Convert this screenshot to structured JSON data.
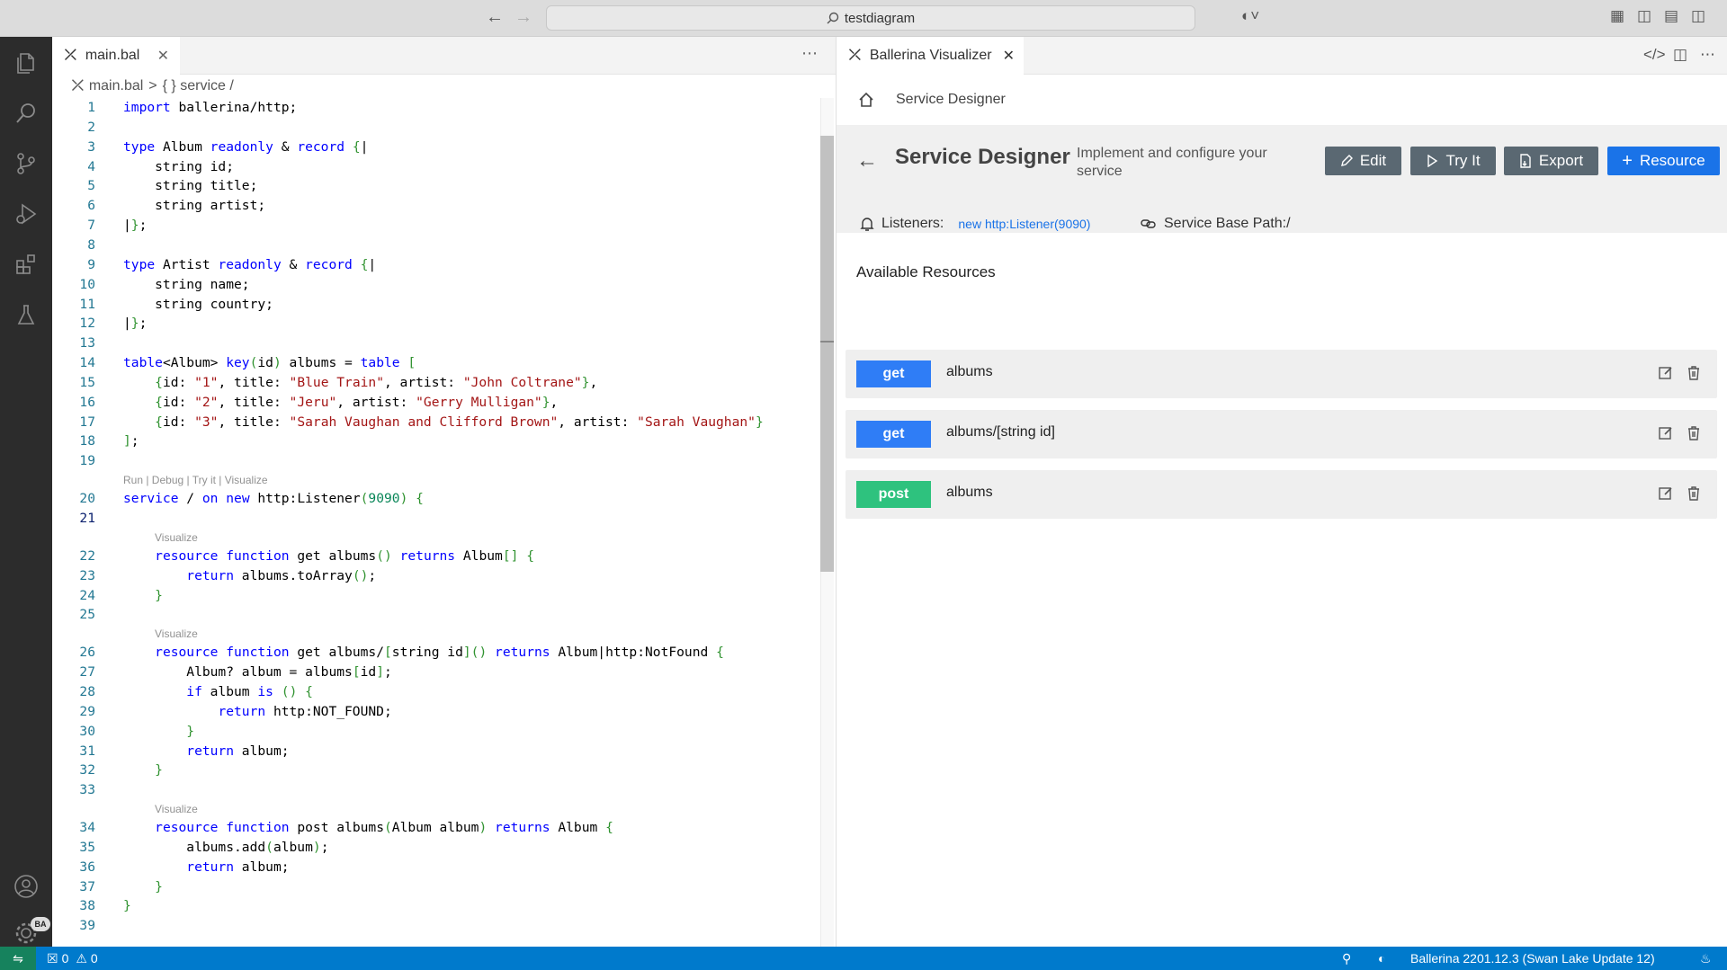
{
  "window": {
    "search_text": "testdiagram"
  },
  "activity_bar": {
    "account_badge": "BA"
  },
  "editor": {
    "tab_label": "main.bal",
    "breadcrumb": {
      "file": "main.bal",
      "separator": ">",
      "symbol": "{ } service /"
    },
    "code_lens_service": "Run | Debug | Try it | Visualize",
    "code_lens_resource": "Visualize",
    "lines": [
      "import ballerina/http;",
      "",
      "type Album readonly & record {|",
      "    string id;",
      "    string title;",
      "    string artist;",
      "|};",
      "",
      "type Artist readonly & record {|",
      "    string name;",
      "    string country;",
      "|};",
      "",
      "table<Album> key(id) albums = table [",
      "    {id: \"1\", title: \"Blue Train\", artist: \"John Coltrane\"},",
      "    {id: \"2\", title: \"Jeru\", artist: \"Gerry Mulligan\"},",
      "    {id: \"3\", title: \"Sarah Vaughan and Clifford Brown\", artist: \"Sarah Vaughan\"}",
      "];",
      "",
      "service / on new http:Listener(9090) {",
      "",
      "    resource function get albums() returns Album[] {",
      "        return albums.toArray();",
      "    }",
      "",
      "    resource function get albums/[string id]() returns Album|http:NotFound {",
      "        Album? album = albums[id];",
      "        if album is () {",
      "            return http:NOT_FOUND;",
      "        }",
      "        return album;",
      "    }",
      "",
      "    resource function post albums(Album album) returns Album {",
      "        albums.add(album);",
      "        return album;",
      "    }",
      "}",
      ""
    ],
    "line_numbers": [
      "1",
      "2",
      "3",
      "4",
      "5",
      "6",
      "7",
      "8",
      "9",
      "10",
      "11",
      "12",
      "13",
      "14",
      "15",
      "16",
      "17",
      "18",
      "19",
      "20",
      "21",
      "22",
      "23",
      "24",
      "25",
      "26",
      "27",
      "28",
      "29",
      "30",
      "31",
      "32",
      "33",
      "34",
      "35",
      "36",
      "37",
      "38",
      "39"
    ]
  },
  "visualizer": {
    "tab_label": "Ballerina Visualizer",
    "breadcrumb": "Service Designer",
    "title": "Service Designer",
    "subtitle": "Implement and configure your service",
    "buttons": {
      "edit": "Edit",
      "try_it": "Try It",
      "export": "Export",
      "resource": "Resource"
    },
    "listeners_label": "Listeners:",
    "listener_value": "new http:Listener(9090)",
    "base_path": "Service Base Path:/",
    "available_resources": "Available Resources",
    "resources": [
      {
        "method": "get",
        "path": "albums"
      },
      {
        "method": "get",
        "path": "albums/[string id]"
      },
      {
        "method": "post",
        "path": "albums"
      }
    ]
  },
  "status_bar": {
    "errors": "0",
    "warnings": "0",
    "version": "Ballerina 2201.12.3 (Swan Lake Update 12)"
  },
  "colors": {
    "accent": "#1a73e8",
    "status_bar": "#007acc",
    "get": "#2f7df6",
    "post": "#2ec27e"
  }
}
